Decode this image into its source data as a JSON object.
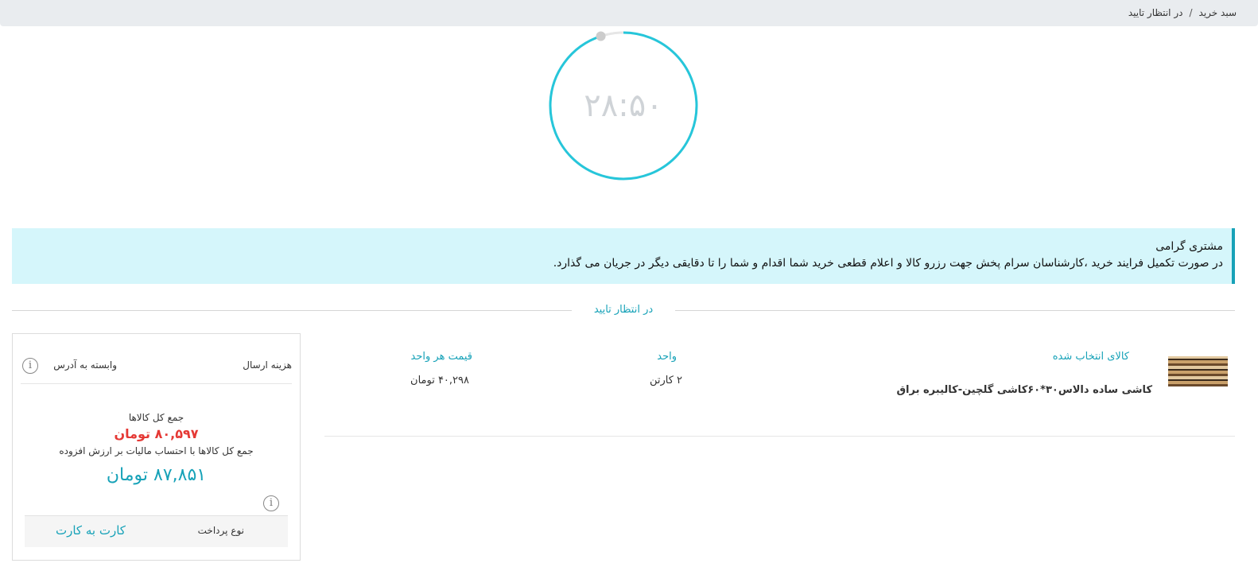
{
  "breadcrumb": {
    "items": [
      "سبد خرید",
      "در انتظار تایید"
    ],
    "separator": "/"
  },
  "timer": {
    "display": "۲۸:۵۰",
    "progress_fraction": 0.95,
    "accent_color": "#26c6da"
  },
  "alert": {
    "title": "مشتری گرامی",
    "body": "در صورت تکمیل فرایند خرید ،کارشناسان سرام پخش جهت رزرو کالا و اعلام قطعی خرید شما اقدام و شما را تا دقایقی دیگر در جریان می گذارد."
  },
  "section_title": "در انتظار تایید",
  "product": {
    "column_labels": {
      "item": "کالای انتخاب شده",
      "unit": "واحد",
      "unit_price": "قیمت هر واحد"
    },
    "name": "کاشی ساده دالاس۳۰*۶۰کاشی گلچین-کالیبره براق",
    "unit": "۲ کارتن",
    "unit_price": "۴۰,۲۹۸ تومان"
  },
  "summary": {
    "shipping_label": "هزینه ارسال",
    "shipping_value": "وابسته به آدرس",
    "total_label": "جمع کل کالاها",
    "total_value": "۸۰,۵۹۷ تومان",
    "vat_label": "جمع کل کالاها با احتساب مالیات بر ارزش افزوده",
    "vat_value": "۸۷,۸۵۱ تومان",
    "payment_label": "نوع پرداخت",
    "payment_value": "کارت به کارت"
  },
  "icons": {
    "info": "info-icon"
  },
  "colors": {
    "accent": "#17a2b8",
    "price_red": "#e53935",
    "alert_bg": "#d5f6fb"
  }
}
